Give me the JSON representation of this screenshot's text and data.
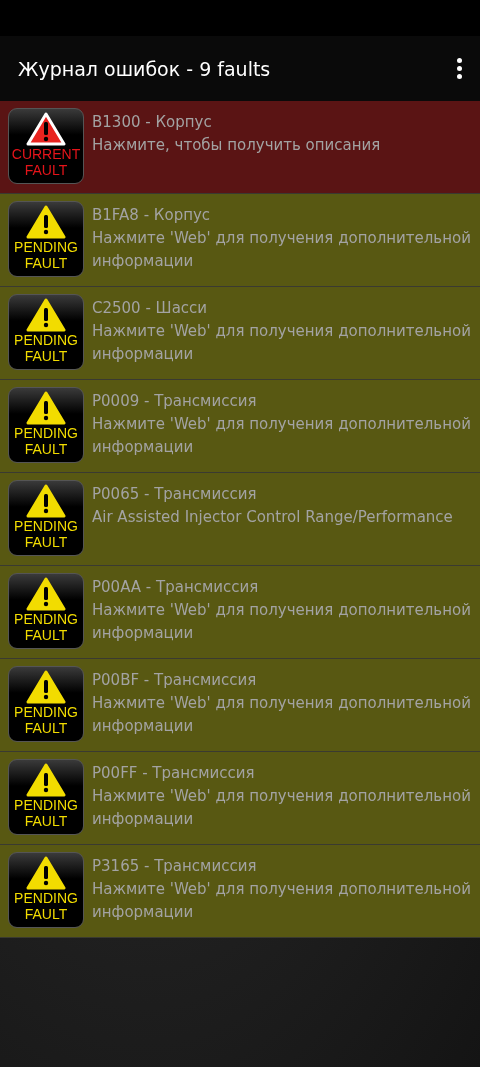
{
  "app_bar": {
    "title": "Журнал ошибок - 9 faults"
  },
  "faults": [
    {
      "kind": "current",
      "badge": [
        "CURRENT",
        "FAULT"
      ],
      "code": "B1300 - Корпус",
      "description": "Нажмите, чтобы получить описания"
    },
    {
      "kind": "pending",
      "badge": [
        "PENDING",
        "FAULT"
      ],
      "code": "B1FA8 - Корпус",
      "description": "Нажмите 'Web' для получения дополнительной информации"
    },
    {
      "kind": "pending",
      "badge": [
        "PENDING",
        "FAULT"
      ],
      "code": "C2500 - Шасси",
      "description": "Нажмите 'Web' для получения дополнительной информации"
    },
    {
      "kind": "pending",
      "badge": [
        "PENDING",
        "FAULT"
      ],
      "code": "P0009 - Трансмиссия",
      "description": "Нажмите 'Web' для получения дополнительной информации"
    },
    {
      "kind": "pending",
      "badge": [
        "PENDING",
        "FAULT"
      ],
      "code": "P0065 - Трансмиссия",
      "description": "Air Assisted Injector Control Range/Performance"
    },
    {
      "kind": "pending",
      "badge": [
        "PENDING",
        "FAULT"
      ],
      "code": "P00AA - Трансмиссия",
      "description": "Нажмите 'Web' для получения дополнительной информации"
    },
    {
      "kind": "pending",
      "badge": [
        "PENDING",
        "FAULT"
      ],
      "code": "P00BF - Трансмиссия",
      "description": "Нажмите 'Web' для получения дополнительной информации"
    },
    {
      "kind": "pending",
      "badge": [
        "PENDING",
        "FAULT"
      ],
      "code": "P00FF - Трансмиссия",
      "description": "Нажмите 'Web' для получения дополнительной информации"
    },
    {
      "kind": "pending",
      "badge": [
        "PENDING",
        "FAULT"
      ],
      "code": "P3165 - Трансмиссия",
      "description": "Нажмите 'Web' для получения дополнительной информации"
    }
  ]
}
